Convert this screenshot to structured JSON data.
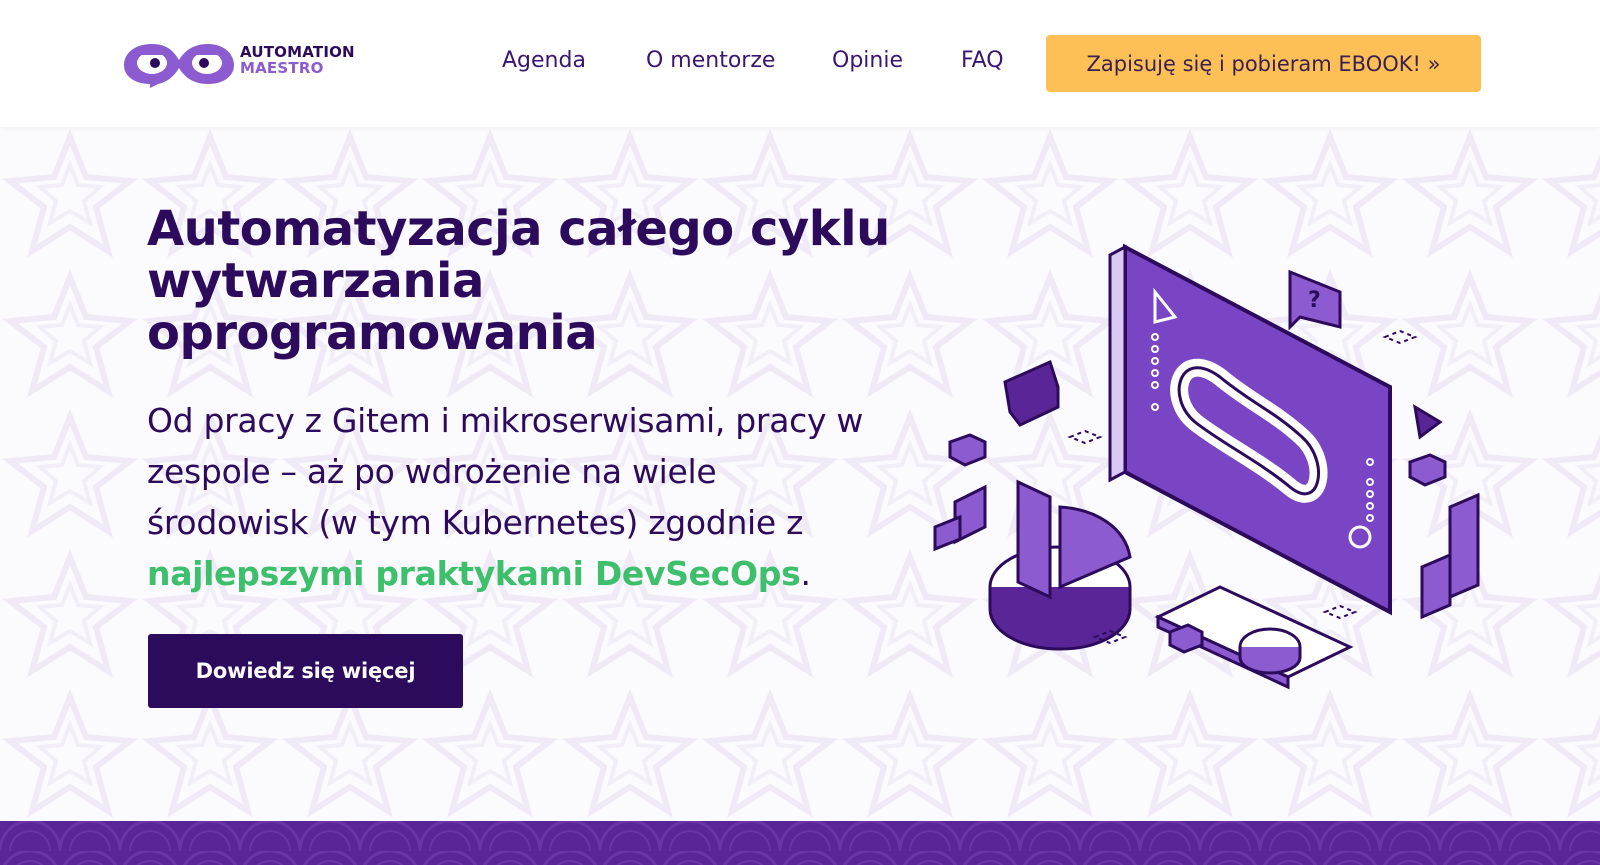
{
  "header": {
    "logo": {
      "line1": "AUTOMATION",
      "line2": "MAESTRO",
      "icon": "infinity-eyes-logo"
    },
    "nav": [
      {
        "label": "Agenda"
      },
      {
        "label": "O mentorze"
      },
      {
        "label": "Opinie"
      },
      {
        "label": "FAQ"
      }
    ],
    "cta_label": "Zapisuję się i pobieram EBOOK! »"
  },
  "hero": {
    "title_lines": [
      "Automatyzacja całego cyklu",
      "wytwarzania",
      "oprogramowania"
    ],
    "text_part1": "Od pracy z Gitem i mikroserwisami, pracy w zespole – aż po wdrożenie na wiele środowisk (w tym Kubernetes) zgodnie z ",
    "text_accent": "najlepszymi praktykami DevSecOps",
    "text_end": ".",
    "button_label": "Dowiedz się więcej",
    "illustration": "devops-monitor-infinity-illustration"
  },
  "colors": {
    "brand_dark": "#2c0a5c",
    "brand_purple": "#8b5bcf",
    "accent_green": "#3dbf6b",
    "cta_yellow": "#fcc056",
    "strip_purple": "#5a2596"
  }
}
